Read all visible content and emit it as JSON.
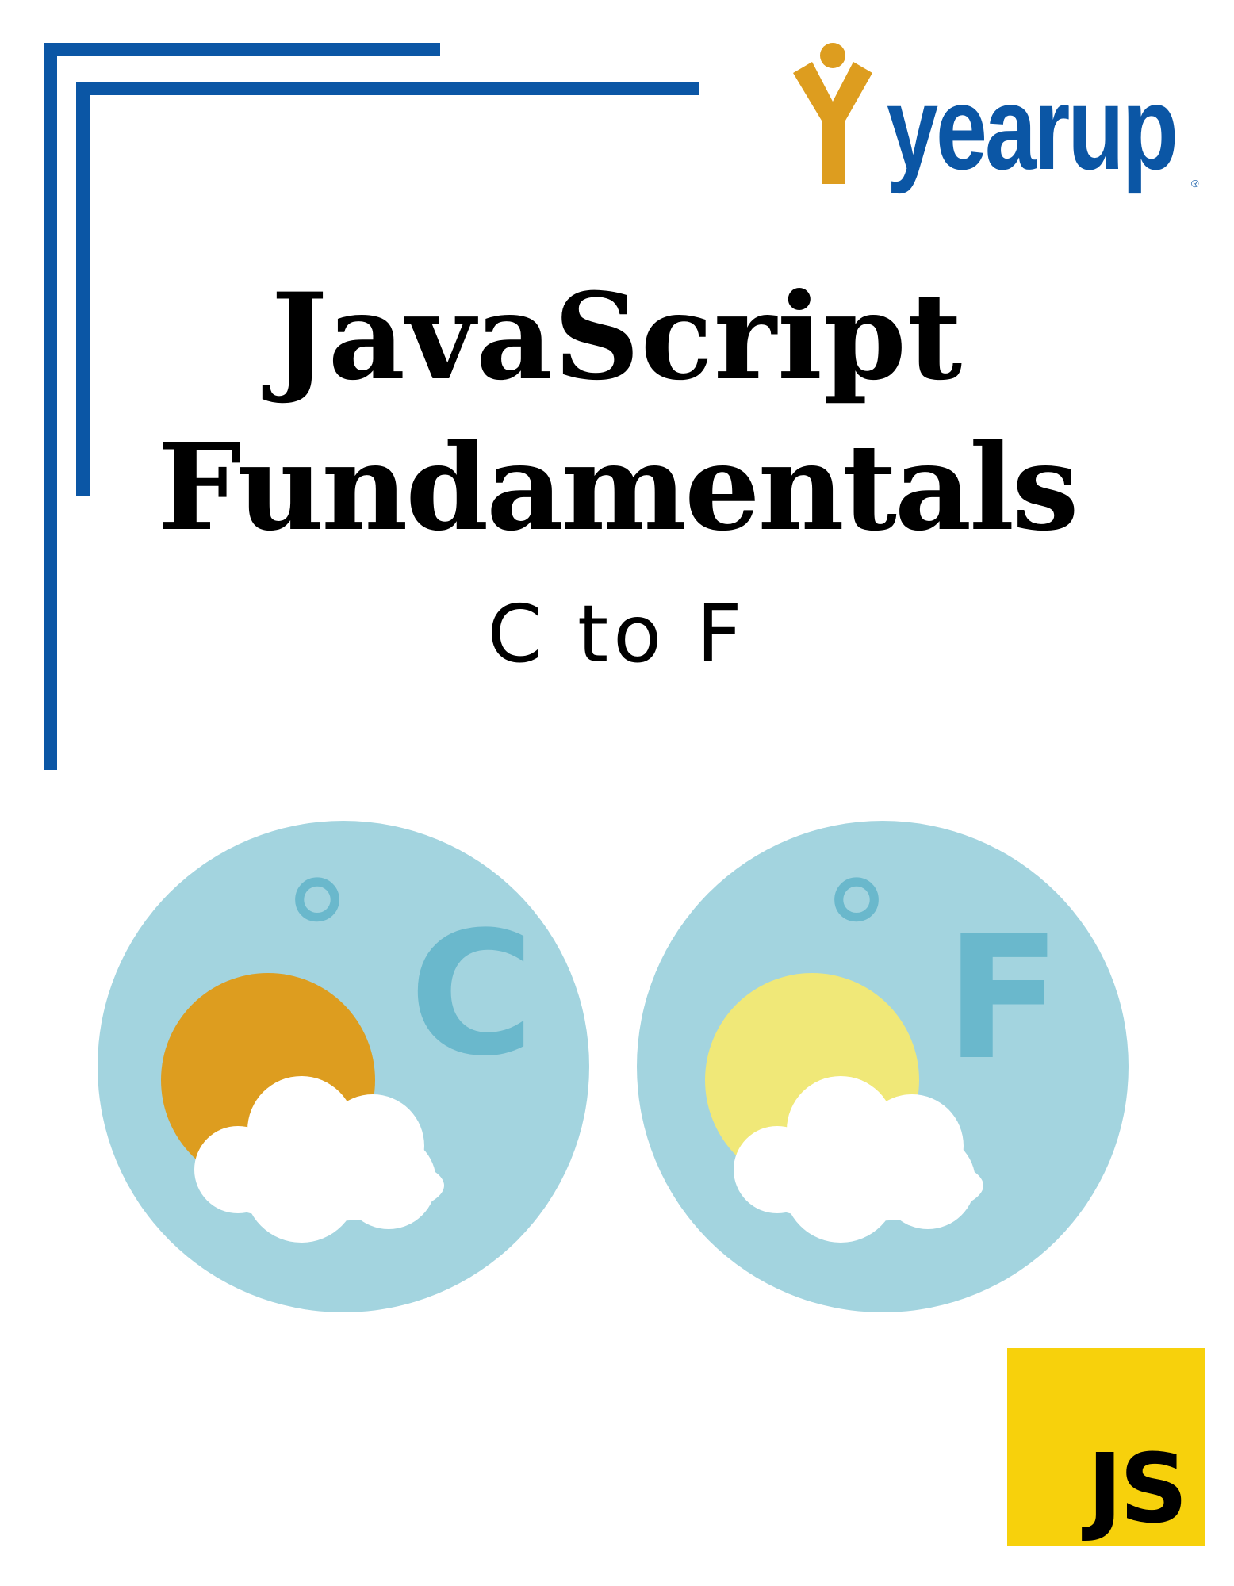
{
  "branding": {
    "logo_text": "yearup",
    "registered_mark": "®"
  },
  "title": {
    "line1": "JavaScript",
    "line2": "Fundamentals"
  },
  "subtitle": "C to F",
  "illustration": {
    "celsius": {
      "degree_symbol": "°",
      "unit_letter": "C",
      "sun_color": "#dd9d1f"
    },
    "fahrenheit": {
      "degree_symbol": "°",
      "unit_letter": "F",
      "sun_color": "#f0e878"
    },
    "circle_color": "#a3d4df",
    "letter_color": "#6ab8cc",
    "cloud_color": "#ffffff"
  },
  "badge": {
    "text": "JS",
    "color": "#f7d10c"
  },
  "colors": {
    "accent_blue": "#0b56a5",
    "logo_figure": "#dd9d1f"
  }
}
